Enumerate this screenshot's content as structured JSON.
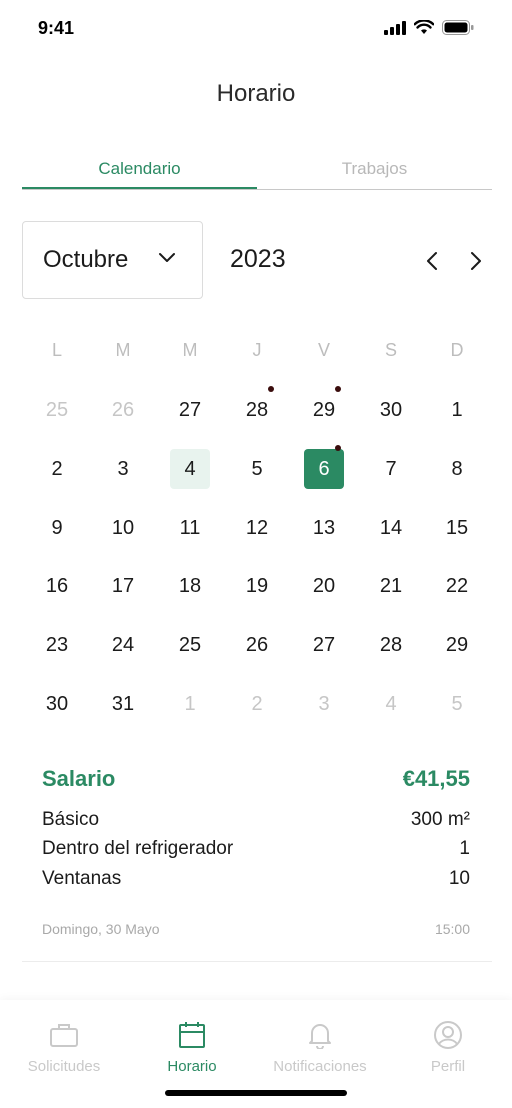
{
  "status_bar": {
    "time": "9:41"
  },
  "header": {
    "title": "Horario"
  },
  "tabs": [
    {
      "label": "Calendario",
      "active": true
    },
    {
      "label": "Trabajos",
      "active": false
    }
  ],
  "calendar": {
    "month": "Octubre",
    "year": "2023",
    "weekdays": [
      "L",
      "M",
      "M",
      "J",
      "V",
      "S",
      "D"
    ],
    "weeks": [
      [
        {
          "d": "25",
          "muted": true
        },
        {
          "d": "26",
          "muted": true
        },
        {
          "d": "27"
        },
        {
          "d": "28",
          "dot": true
        },
        {
          "d": "29",
          "dot": true
        },
        {
          "d": "30"
        },
        {
          "d": "1"
        }
      ],
      [
        {
          "d": "2"
        },
        {
          "d": "3"
        },
        {
          "d": "4",
          "today": true
        },
        {
          "d": "5"
        },
        {
          "d": "6",
          "selected": true,
          "dot": true
        },
        {
          "d": "7"
        },
        {
          "d": "8"
        }
      ],
      [
        {
          "d": "9"
        },
        {
          "d": "10"
        },
        {
          "d": "11"
        },
        {
          "d": "12"
        },
        {
          "d": "13"
        },
        {
          "d": "14"
        },
        {
          "d": "15"
        }
      ],
      [
        {
          "d": "16"
        },
        {
          "d": "17"
        },
        {
          "d": "18"
        },
        {
          "d": "19"
        },
        {
          "d": "20"
        },
        {
          "d": "21"
        },
        {
          "d": "22"
        }
      ],
      [
        {
          "d": "23"
        },
        {
          "d": "24"
        },
        {
          "d": "25"
        },
        {
          "d": "26"
        },
        {
          "d": "27"
        },
        {
          "d": "28"
        },
        {
          "d": "29"
        }
      ],
      [
        {
          "d": "30"
        },
        {
          "d": "31"
        },
        {
          "d": "1",
          "muted": true
        },
        {
          "d": "2",
          "muted": true
        },
        {
          "d": "3",
          "muted": true
        },
        {
          "d": "4",
          "muted": true
        },
        {
          "d": "5",
          "muted": true
        }
      ]
    ]
  },
  "salary": {
    "title": "Salario",
    "amount": "€41,55",
    "details": [
      {
        "label": "Básico",
        "value": "300 m²"
      },
      {
        "label": "Dentro del refrigerador",
        "value": "1"
      },
      {
        "label": "Ventanas",
        "value": "10"
      }
    ],
    "date": "Domingo, 30 Mayo",
    "time": "15:00"
  },
  "bottom_nav": [
    {
      "label": "Solicitudes",
      "icon": "briefcase-icon",
      "active": false
    },
    {
      "label": "Horario",
      "icon": "calendar-icon",
      "active": true
    },
    {
      "label": "Notificaciones",
      "icon": "bell-icon",
      "active": false
    },
    {
      "label": "Perfil",
      "icon": "profile-icon",
      "active": false
    }
  ],
  "colors": {
    "accent": "#2b8a63",
    "today_bg": "#e8f3ee",
    "event_dot": "#3a0d0d",
    "muted": "#c6c6c6"
  }
}
